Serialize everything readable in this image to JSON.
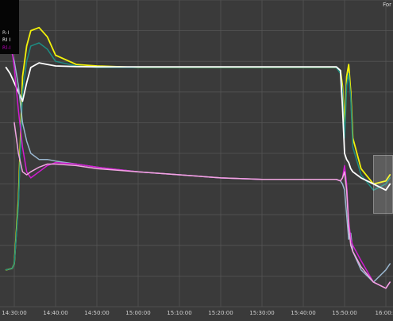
{
  "corner_label": "For",
  "legend": [
    {
      "label": "R-I",
      "color": "#d8d8d8"
    },
    {
      "label": "RI I",
      "color": "#ffffff"
    },
    {
      "label": "Rl-I",
      "color": "#c000c0"
    }
  ],
  "colors": {
    "background": "#3a3a3a",
    "grid": "#555555",
    "yellow": "#f2f20a",
    "teal": "#1e8c82",
    "white": "#ffffff",
    "lightblue": "#9ab7d0",
    "magenta": "#d21ad2",
    "pink": "#f0a6e0"
  },
  "chart_data": {
    "type": "line",
    "title": "",
    "xlabel": "",
    "ylabel": "",
    "grid": true,
    "legend_position": "top-left",
    "x_ticks": [
      "14:30:00",
      "14:40:00",
      "14:50:00",
      "15:00:00",
      "15:10:00",
      "15:20:00",
      "15:30:00",
      "15:40:00",
      "15:50:00",
      "16:00:0"
    ],
    "xlim": [
      "14:28:00",
      "16:01:00"
    ],
    "ylim": [
      0,
      100
    ],
    "series": [
      {
        "color": "yellow",
        "x": [
          "14:28:00",
          "14:29:30",
          "14:30:00",
          "14:31:00",
          "14:32:00",
          "14:33:00",
          "14:34:00",
          "14:36:00",
          "14:38:00",
          "14:40:00",
          "14:45:00",
          "14:50:00",
          "15:00:00",
          "15:10:00",
          "15:20:00",
          "15:30:00",
          "15:40:00",
          "15:48:00",
          "15:49:00",
          "15:49:30",
          "15:50:00",
          "15:50:30",
          "15:51:00",
          "15:51:30",
          "15:52:00",
          "15:54:00",
          "15:57:00",
          "16:00:00",
          "16:01:00"
        ],
        "y": [
          12,
          12.5,
          14,
          35,
          75,
          85,
          90,
          91,
          88,
          82,
          79,
          78.5,
          78,
          78,
          78,
          78,
          78,
          78,
          77,
          72,
          58,
          75,
          79,
          70,
          55,
          45,
          40,
          41,
          43
        ]
      },
      {
        "color": "teal",
        "x": [
          "14:28:00",
          "14:29:30",
          "14:30:00",
          "14:31:00",
          "14:32:00",
          "14:33:00",
          "14:34:00",
          "14:36:00",
          "14:38:00",
          "14:40:00",
          "14:45:00",
          "14:50:00",
          "15:00:00",
          "15:10:00",
          "15:20:00",
          "15:30:00",
          "15:40:00",
          "15:48:00",
          "15:49:00",
          "15:49:30",
          "15:50:00",
          "15:50:30",
          "15:51:00",
          "15:51:30",
          "15:52:00",
          "15:54:00",
          "15:57:00",
          "16:00:00",
          "16:01:00"
        ],
        "y": [
          12,
          12.5,
          14,
          33,
          70,
          80,
          85,
          86,
          84,
          80,
          78.5,
          78,
          78,
          78,
          78,
          78,
          78,
          78,
          76,
          70,
          55,
          72,
          76,
          68,
          52,
          43,
          38,
          40,
          42
        ]
      },
      {
        "color": "white",
        "x": [
          "14:28:00",
          "14:29:00",
          "14:30:00",
          "14:31:00",
          "14:32:00",
          "14:33:00",
          "14:34:00",
          "14:36:00",
          "14:38:00",
          "14:40:00",
          "14:45:00",
          "14:50:00",
          "15:00:00",
          "15:10:00",
          "15:20:00",
          "15:30:00",
          "15:40:00",
          "15:48:00",
          "15:49:00",
          "15:49:30",
          "15:50:00",
          "15:50:30",
          "15:51:00",
          "15:51:30",
          "15:52:00",
          "15:54:00",
          "15:57:00",
          "16:00:00",
          "16:01:00"
        ],
        "y": [
          78,
          76,
          73,
          70,
          67,
          73,
          78,
          79.5,
          79,
          78.5,
          78.3,
          78.2,
          78.2,
          78.2,
          78.2,
          78.2,
          78.2,
          78.2,
          77,
          65,
          50,
          48,
          47,
          45,
          44,
          42,
          40,
          38,
          40
        ]
      },
      {
        "color": "lightblue",
        "x": [
          "14:28:00",
          "14:29:00",
          "14:30:00",
          "14:31:00",
          "14:32:00",
          "14:33:00",
          "14:34:00",
          "14:36:00",
          "14:38:00",
          "14:40:00",
          "14:45:00",
          "14:50:00",
          "15:00:00",
          "15:10:00",
          "15:20:00",
          "15:30:00",
          "15:40:00",
          "15:48:00",
          "15:49:00",
          "15:49:30",
          "15:50:00",
          "15:50:30",
          "15:51:00",
          "15:51:30",
          "15:52:00",
          "15:54:00",
          "15:57:00",
          "16:00:00",
          "16:01:00"
        ],
        "y": [
          88,
          85,
          80,
          72,
          60,
          54,
          50,
          48,
          48,
          47.5,
          46.5,
          45.5,
          44,
          43,
          42,
          41.5,
          41.5,
          41.5,
          41,
          40,
          38,
          30,
          22,
          24,
          18,
          12,
          8,
          12,
          14
        ]
      },
      {
        "color": "magenta",
        "x": [
          "14:28:00",
          "14:29:00",
          "14:29:30",
          "14:30:00",
          "14:31:00",
          "14:32:00",
          "14:33:00",
          "14:34:00",
          "14:36:00",
          "14:38:00",
          "14:40:00",
          "14:45:00",
          "14:50:00",
          "15:00:00",
          "15:10:00",
          "15:20:00",
          "15:30:00",
          "15:40:00",
          "15:48:00",
          "15:49:00",
          "15:49:30",
          "15:50:00",
          "15:50:30",
          "15:51:00",
          "15:51:30",
          "15:52:00",
          "15:54:00",
          "15:57:00",
          "16:00:00",
          "16:01:00"
        ],
        "y": [
          95,
          90,
          83,
          78,
          64,
          52,
          44,
          42,
          44,
          46,
          47,
          46.5,
          45.5,
          44,
          43,
          42,
          41.5,
          41.5,
          41.5,
          41,
          42,
          46,
          40,
          28,
          22,
          20,
          15,
          8,
          6,
          8
        ]
      },
      {
        "color": "pink",
        "x": [
          "14:30:00",
          "14:31:00",
          "14:32:00",
          "14:33:00",
          "14:34:00",
          "14:36:00",
          "14:38:00",
          "14:40:00",
          "14:45:00",
          "14:50:00",
          "15:00:00",
          "15:10:00",
          "15:20:00",
          "15:30:00",
          "15:40:00",
          "15:48:00",
          "15:49:00",
          "15:49:30",
          "15:50:00",
          "15:50:30",
          "15:51:00",
          "15:51:30",
          "15:52:00",
          "15:54:00",
          "15:57:00",
          "16:00:00",
          "16:01:00"
        ],
        "y": [
          60,
          50,
          44,
          43,
          44,
          45.5,
          46.5,
          46.5,
          46,
          45,
          44,
          43,
          42,
          41.5,
          41.5,
          41.5,
          41,
          42,
          44,
          38,
          26,
          20,
          18,
          13,
          8,
          6,
          8
        ]
      }
    ]
  }
}
